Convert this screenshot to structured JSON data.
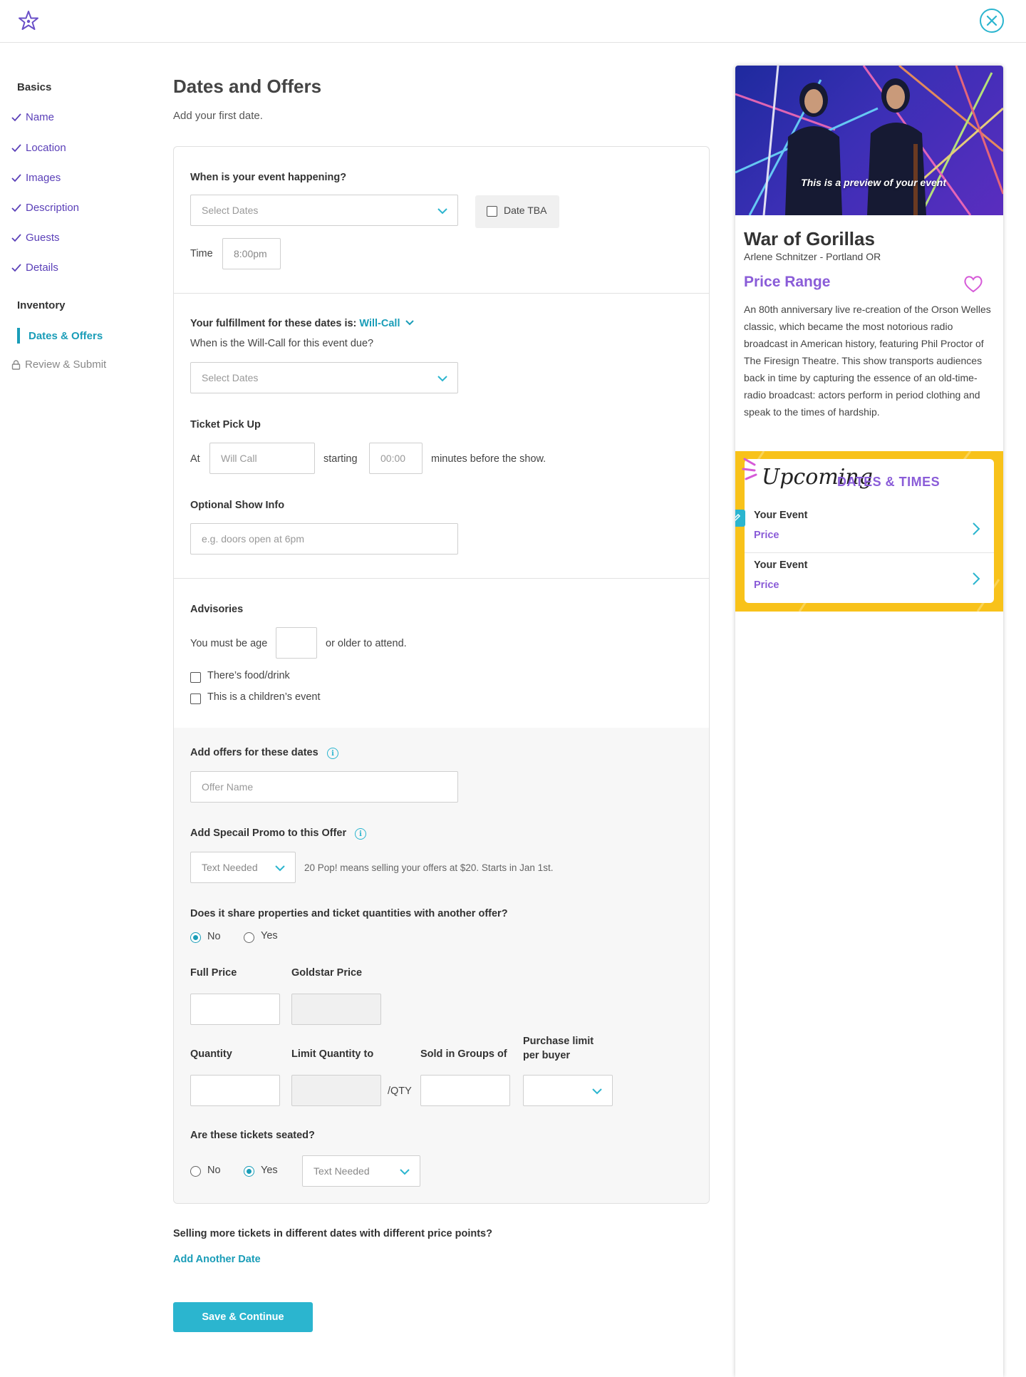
{
  "sidebar": {
    "basics_heading": "Basics",
    "basics_items": [
      "Name",
      "Location",
      "Images",
      "Description",
      "Guests",
      "Details"
    ],
    "inventory_heading": "Inventory",
    "active_item": "Dates & Offers",
    "locked_item": "Review & Submit"
  },
  "main": {
    "title": "Dates and Offers",
    "subtitle": "Add your first date.",
    "when_label": "When is your event happening?",
    "select_dates_placeholder": "Select Dates",
    "date_tba_label": "Date TBA",
    "time_label": "Time",
    "time_value": "8:00pm",
    "fulfillment_prefix": "Your fulfillment for these dates is:",
    "fulfillment_value": "Will-Call",
    "willcall_due_label": "When is the Will-Call for this event due?",
    "willcall_dates_placeholder": "Select Dates",
    "pickup_label": "Ticket Pick Up",
    "pickup_at": "At",
    "pickup_location_placeholder": "Will Call",
    "pickup_starting": "starting",
    "pickup_minutes_placeholder": "00:00",
    "pickup_suffix": "minutes before the show.",
    "showinfo_label": "Optional Show Info",
    "showinfo_placeholder": "e.g. doors open at 6pm",
    "advisories_label": "Advisories",
    "age_prefix": "You must be age",
    "age_suffix": "or older to attend.",
    "food_drink_label": "There’s food/drink",
    "children_label": "This is a children’s event",
    "offers_label": "Add offers for these dates",
    "offer_name_placeholder": "Offer Name",
    "promo_label": "Add Specail Promo to this Offer",
    "promo_select": "Text Needed",
    "promo_note": "20 Pop! means selling your offers at $20. Starts in Jan 1st.",
    "share_question": "Does it share properties and ticket quantities with another offer?",
    "share_no": "No",
    "share_yes": "Yes",
    "share_selected": "No",
    "full_price_label": "Full Price",
    "goldstar_price_label": "Goldstar Price",
    "quantity_label": "Quantity",
    "limit_qty_label": "Limit Quantity to",
    "qty_suffix": "/QTY",
    "groups_label": "Sold in Groups of",
    "purchase_limit_label_1": "Purchase limit",
    "purchase_limit_label_2": "per buyer",
    "seated_question": "Are these tickets seated?",
    "seated_no": "No",
    "seated_yes": "Yes",
    "seated_selected": "Yes",
    "seated_select": "Text Needed",
    "more_dates_question": "Selling more tickets in different dates with different price points?",
    "add_date_link": "Add Another Date",
    "save_button": "Save & Continue"
  },
  "preview": {
    "caption": "This is a preview of your event",
    "event_title": "War of Gorillas",
    "venue": "Arlene Schnitzer - Portland OR",
    "price_range": "Price Range",
    "description": "An 80th anniversary live re-creation of the Orson Welles classic, which became the most notorious radio broadcast in American history, featuring Phil Proctor of The Firesign Theatre. This show transports audiences back in time by capturing the essence of an old-time-radio broadcast: actors perform in period clothing and speak to the times of hardship.",
    "upcoming_script": "Upcoming",
    "dates_times": "DATES & TIMES",
    "events": [
      {
        "name": "Your Event",
        "price": "Price"
      },
      {
        "name": "Your Event",
        "price": "Price"
      }
    ]
  },
  "colors": {
    "accent_teal": "#2bb5cf",
    "accent_purple": "#8a5cd8",
    "nav_purple": "#5a3fb8",
    "upcoming_yellow": "#f8c21a"
  },
  "icons": [
    "logo-star-icon",
    "close-icon",
    "check-icon",
    "lock-icon",
    "chevron-down-icon",
    "info-icon",
    "heart-icon",
    "chevron-right-icon",
    "pencil-icon"
  ]
}
